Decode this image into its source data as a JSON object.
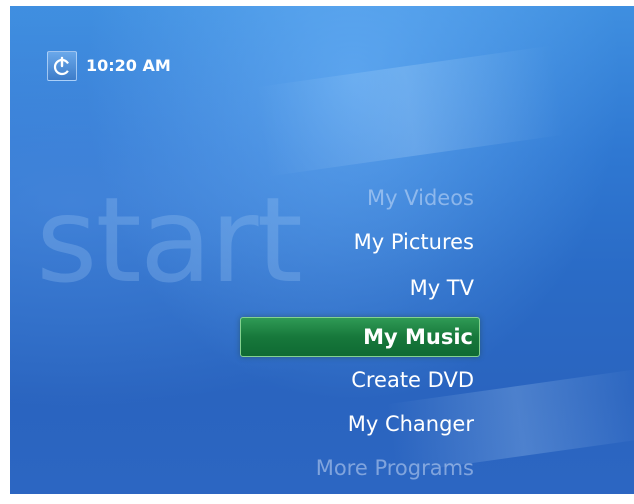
{
  "header": {
    "power_icon": "power-icon",
    "time": "10:20 AM"
  },
  "watermark": "start",
  "menu": {
    "items": [
      {
        "label": "My Videos",
        "state": "faded"
      },
      {
        "label": "My Pictures",
        "state": "normal"
      },
      {
        "label": "My TV",
        "state": "normal"
      },
      {
        "label": "My Music",
        "state": "selected"
      },
      {
        "label": "Create DVD",
        "state": "normal"
      },
      {
        "label": "My Changer",
        "state": "normal"
      },
      {
        "label": "More Programs",
        "state": "faded"
      }
    ],
    "selected_color": "#1b7d3e"
  },
  "colors": {
    "background": "#2f78d2",
    "text": "#ffffff"
  }
}
